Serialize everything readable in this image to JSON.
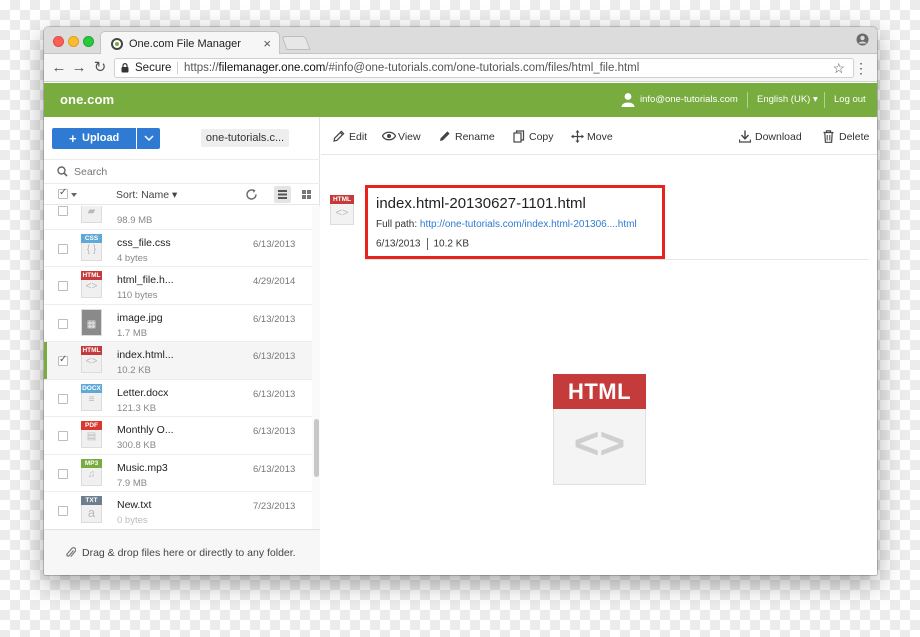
{
  "browser": {
    "tab_title": "One.com File Manager",
    "tab_close": "×",
    "secure_label": "Secure",
    "url_scheme": "https://",
    "url_host": "filemanager.one.com",
    "url_rest": "/#info@one-tutorials.com/one-tutorials.com/files/html_file.html"
  },
  "header": {
    "logo": "one.com",
    "user_email": "info@one-tutorials.com",
    "language": "English (UK) ▾",
    "logout": "Log out",
    "accent_color": "#78ac3e"
  },
  "sidebar": {
    "upload_label": "Upload",
    "upload_plus": "+",
    "upload_caret": "⌄",
    "folder_chip": "one-tutorials.c...",
    "search_placeholder": "Search",
    "sort_label": "Sort: Name ▾",
    "dropzone_text": "Drag & drop files here or directly to any folder."
  },
  "files": [
    {
      "name": "",
      "size": "98.9 MB",
      "date": "",
      "badge": "",
      "badge_color": "#9e9e9e",
      "glyph": "▰",
      "selected": false
    },
    {
      "name": "css_file.css",
      "size": "4 bytes",
      "date": "6/13/2013",
      "badge": "CSS",
      "badge_color": "#5ea9d8",
      "glyph": "{ }",
      "selected": false
    },
    {
      "name": "html_file.h...",
      "size": "110 bytes",
      "date": "4/29/2014",
      "badge": "HTML",
      "badge_color": "#c53a3a",
      "glyph": "<>",
      "selected": false
    },
    {
      "name": "image.jpg",
      "size": "1.7 MB",
      "date": "6/13/2013",
      "badge": "",
      "badge_color": "#555555",
      "glyph": "▦",
      "selected": false
    },
    {
      "name": "index.html...",
      "size": "10.2 KB",
      "date": "6/13/2013",
      "badge": "HTML",
      "badge_color": "#c53a3a",
      "glyph": "<>",
      "selected": true
    },
    {
      "name": "Letter.docx",
      "size": "121.3 KB",
      "date": "6/13/2013",
      "badge": "DOCX",
      "badge_color": "#5ea9d8",
      "glyph": "≡",
      "selected": false
    },
    {
      "name": "Monthly O...",
      "size": "300.8 KB",
      "date": "6/13/2013",
      "badge": "PDF",
      "badge_color": "#d9382f",
      "glyph": "▤",
      "selected": false
    },
    {
      "name": "Music.mp3",
      "size": "7.9 MB",
      "date": "6/13/2013",
      "badge": "MP3",
      "badge_color": "#78ac3e",
      "glyph": "♫",
      "selected": false
    },
    {
      "name": "New.txt",
      "size": "0 bytes",
      "date": "7/23/2013",
      "badge": "TXT",
      "badge_color": "#6d7f8e",
      "glyph": "a",
      "selected": false
    }
  ],
  "actions": {
    "edit": "Edit",
    "view": "View",
    "rename": "Rename",
    "copy": "Copy",
    "move": "Move",
    "download": "Download",
    "delete": "Delete"
  },
  "details": {
    "filename": "index.html-20130627-1101.html",
    "full_path_label": "Full path:",
    "full_path": "http://one-tutorials.com/index.html-201306....html",
    "date": "6/13/2013",
    "size": "10.2 KB",
    "small_badge": "HTML",
    "small_glyph": "<>",
    "preview_badge": "HTML",
    "preview_glyph": "<>",
    "highlight_color": "#e8221c"
  }
}
